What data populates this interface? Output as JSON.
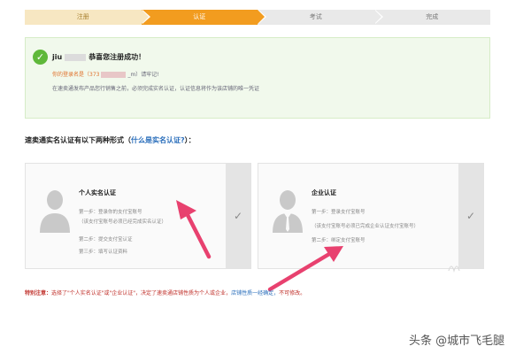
{
  "steps": [
    {
      "label": "注册",
      "state": "done"
    },
    {
      "label": "认证",
      "state": "active"
    },
    {
      "label": "考试",
      "state": "todo"
    },
    {
      "label": "完成",
      "state": "todo"
    }
  ],
  "success": {
    "user_prefix": "jiu",
    "title": "恭喜您注册成功！",
    "login_prefix": "你的登录名是（373",
    "login_suffix": "_m）请牢记!",
    "info_line": "在速卖通发布产品您行销售之前，必须完成实名认证，认证信息将作为该店铺的唯一凭证"
  },
  "heading": {
    "text": "速卖通实名认证有以下两种形式（",
    "link": "什么是实名认证?",
    "suffix": "）："
  },
  "cards": [
    {
      "title": "个人实名认证",
      "lines": [
        "第一步：登录你的支付宝账号",
        "（该支付宝账号必须已经完成实名认证）",
        "第二步：提交支付宝认证",
        "第三步：填写认证资料"
      ],
      "check": "✓"
    },
    {
      "title": "企业认证",
      "lines": [
        "第一步：登录支付宝账号",
        "（该支付宝账号必须已完成企业认证支付宝账号）",
        "第二步：绑定支付宝账号"
      ],
      "check": "✓"
    }
  ],
  "note": {
    "label": "特别注意：",
    "text": "选择了\"个人实名认证\"或\"企业认证\"，决定了速卖通店铺性质为个人或企业，",
    "link": "店铺性质一经确定，",
    "tail": "不可修改。"
  },
  "watermark": "头条 @城市飞毛腿",
  "colors": {
    "step_active": "#f29c1f",
    "step_done": "#f7e7c2",
    "success_bg": "#f1f9ec",
    "success_check": "#5fb83a",
    "link": "#2a6ebb",
    "warning": "#c0302a",
    "arrow": "#e8416f"
  },
  "icons": [
    "check-circle-icon",
    "user-avatar-icon",
    "business-user-avatar-icon",
    "checkmark-icon"
  ]
}
